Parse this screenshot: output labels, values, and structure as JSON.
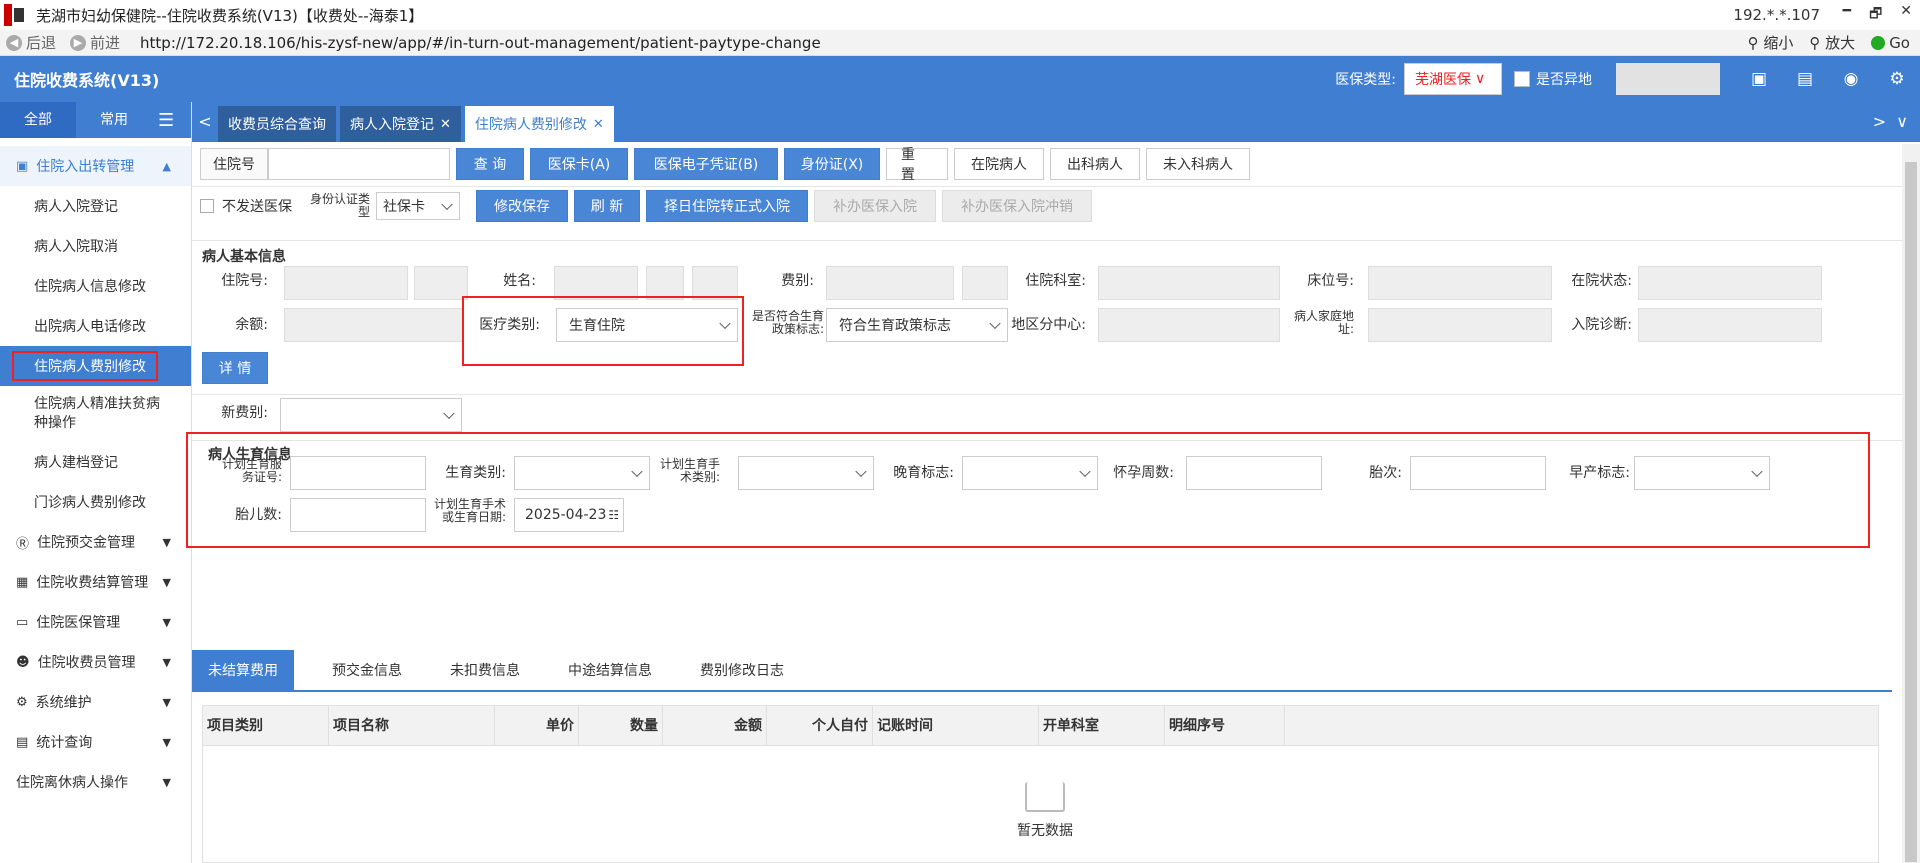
{
  "window": {
    "title": "芜湖市妇幼保健院--住院收费系统(V13)【收费处--海泰1】",
    "ip": "192.*.*.107",
    "controls": [
      "━",
      "🗗",
      "✕"
    ]
  },
  "browser": {
    "back": "后退",
    "forward": "前进",
    "url": "http://172.20.18.106/his-zysf-new/app/#/in-turn-out-management/patient-paytype-change",
    "zoom_out": "缩小",
    "zoom_in": "放大",
    "go": "Go"
  },
  "header": {
    "app_title": "住院收费系统(V13)",
    "insurance_type_label": "医保类型:",
    "insurance_type_value": "芜湖医保",
    "remote_label": "是否异地"
  },
  "sidebar": {
    "tabs": [
      "全部",
      "常用"
    ],
    "groups": [
      {
        "label": "住院入出转管理",
        "open": true,
        "items": [
          "病人入院登记",
          "病人入院取消",
          "住院病人信息修改",
          "出院病人电话修改",
          "住院病人费别修改",
          "住院病人精准扶贫病种操作",
          "病人建档登记",
          "门诊病人费别修改"
        ]
      },
      {
        "label": "住院预交金管理"
      },
      {
        "label": "住院收费结算管理"
      },
      {
        "label": "住院医保管理"
      },
      {
        "label": "住院收费员管理"
      },
      {
        "label": "系统维护"
      },
      {
        "label": "统计查询"
      },
      {
        "label": "住院离休病人操作"
      }
    ]
  },
  "tabs": [
    {
      "label": "收费员综合查询",
      "closable": false
    },
    {
      "label": "病人入院登记",
      "closable": true
    },
    {
      "label": "住院病人费别修改",
      "closable": true,
      "active": true
    }
  ],
  "toolbar": {
    "inpatient_no_label": "住院号",
    "buttons": [
      "查 询",
      "医保卡(A)",
      "医保电子凭证(B)",
      "身份证(X)",
      "重 置",
      "在院病人",
      "出科病人",
      "未入科病人"
    ]
  },
  "row2": {
    "no_send_label": "不发送医保",
    "id_type_label": "身份认证类型",
    "id_type_value": "社保卡",
    "buttons": [
      "修改保存",
      "刷 新",
      "择日住院转正式入院"
    ],
    "disabled_buttons": [
      "补办医保入院",
      "补办医保入院冲销"
    ]
  },
  "basic": {
    "section_title": "病人基本信息",
    "labels": {
      "inpatient_no": "住院号:",
      "name": "姓名:",
      "fee_type": "费别:",
      "dept": "住院科室:",
      "bed": "床位号:",
      "status": "在院状态:",
      "balance": "余额:",
      "med_type": "医疗类别:",
      "policy": "是否符合生育政策标志:",
      "region": "地区分中心:",
      "address": "病人家庭地址:",
      "diagnosis": "入院诊断:"
    },
    "med_type_value": "生育住院",
    "policy_value": "符合生育政策标志",
    "detail_button": "详 情",
    "new_fee_label": "新费别:"
  },
  "birth": {
    "section_title": "病人生育信息",
    "labels": {
      "plan_cert": "计划生育服务证号:",
      "birth_type": "生育类别:",
      "plan_op_type": "计划生育手术类别:",
      "late_birth": "晚育标志:",
      "gest_weeks": "怀孕周数:",
      "parity": "胎次:",
      "premature": "早产标志:",
      "fetus_count": "胎儿数:",
      "op_date": "计划生育手术或生育日期:"
    },
    "date_value": "2025-04-23"
  },
  "bottom_tabs": [
    "未结算费用",
    "预交金信息",
    "未扣费信息",
    "中途结算信息",
    "费别修改日志"
  ],
  "grid": {
    "columns": [
      "项目类别",
      "项目名称",
      "单价",
      "数量",
      "金额",
      "个人自付",
      "记账时间",
      "开单科室",
      "明细序号"
    ],
    "empty_text": "暂无数据"
  }
}
